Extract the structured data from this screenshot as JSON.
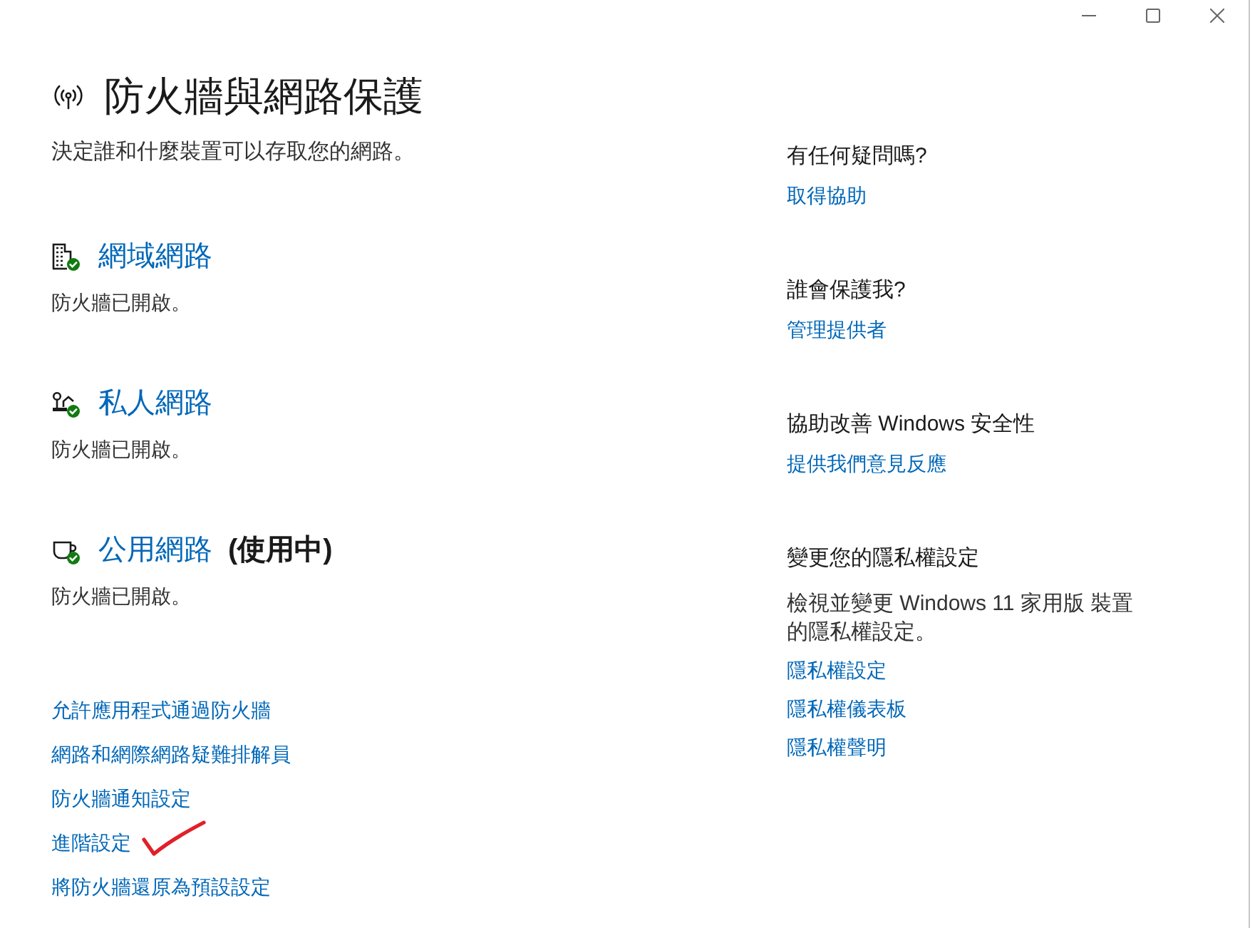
{
  "header": {
    "title": "防火牆與網路保護",
    "subtitle": "決定誰和什麼裝置可以存取您的網路。"
  },
  "networks": [
    {
      "kind": "domain",
      "name": "網域網路",
      "firewall_on": true,
      "status": "防火牆已開啟。"
    },
    {
      "kind": "private",
      "name": "私人網路",
      "firewall_on": true,
      "status": "防火牆已開啟。"
    },
    {
      "kind": "public",
      "name": "公用網路",
      "active_label": "(使用中)",
      "firewall_on": true,
      "status": "防火牆已開啟。"
    }
  ],
  "links": [
    {
      "label": "允許應用程式通過防火牆",
      "marked": false
    },
    {
      "label": "網路和網際網路疑難排解員",
      "marked": false
    },
    {
      "label": "防火牆通知設定",
      "marked": false
    },
    {
      "label": "進階設定",
      "marked": true
    },
    {
      "label": "將防火牆還原為預設設定",
      "marked": false
    }
  ],
  "side": [
    {
      "heading": "有任何疑問嗎?",
      "links": [
        "取得協助"
      ]
    },
    {
      "heading": "誰會保護我?",
      "links": [
        "管理提供者"
      ]
    },
    {
      "heading": "協助改善 Windows 安全性",
      "links": [
        "提供我們意見反應"
      ]
    },
    {
      "heading": "變更您的隱私權設定",
      "description": "檢視並變更 Windows 11 家用版 裝置的隱私權設定。",
      "links": [
        "隱私權設定",
        "隱私權儀表板",
        "隱私權聲明"
      ]
    }
  ]
}
